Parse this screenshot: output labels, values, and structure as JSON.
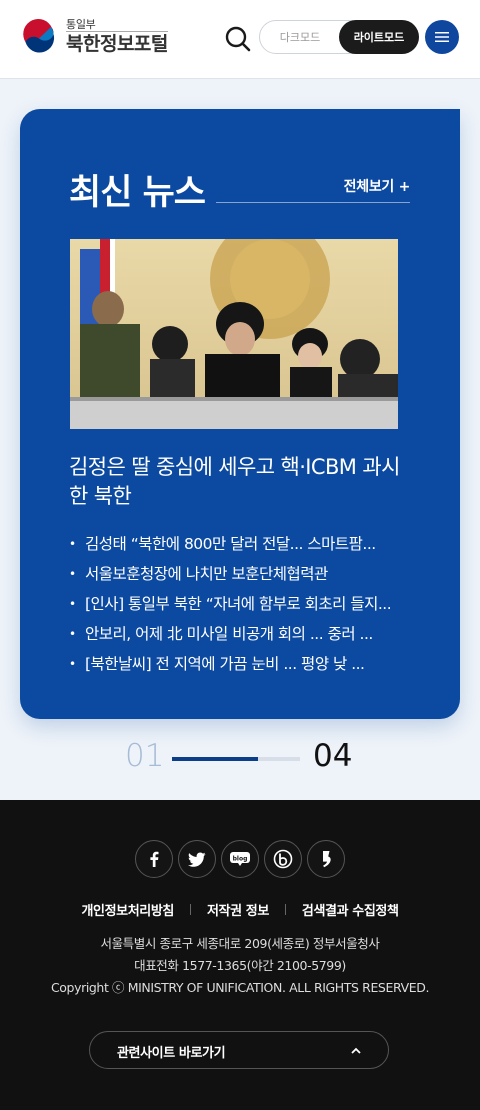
{
  "header": {
    "ministry": "통일부",
    "site_title": "북한정보포털",
    "dark_mode_label": "다크모드",
    "light_mode_label": "라이트모드",
    "active_mode": "light"
  },
  "news": {
    "heading": "최신 뉴스",
    "view_all": "전체보기 +",
    "photo_icon": "news-photo",
    "featured_title": "김정은 딸 중심에 세우고 핵·ICBM 과시한 북한",
    "items": [
      "김성태 “북한에 800만 달러 전달... 스마트팜...",
      "서울보훈청장에 나치만 보훈단체협력관",
      "[인사] 통일부 북한 “자녀에 함부로 회초리 들지...",
      "안보리, 어제 北 미사일 비공개 회의 ... 중러 ...",
      "[북한날씨] 전 지역에 가끔 눈비 ... 평양 낮 ..."
    ]
  },
  "pager": {
    "current": "01",
    "total": "04",
    "progress": 0.67
  },
  "footer": {
    "sns": [
      "facebook-icon",
      "twitter-icon",
      "blog-icon",
      "band-icon",
      "kakao-story-icon"
    ],
    "links": [
      "개인정보처리방침",
      "저작권 정보",
      "검색결과 수집정책"
    ],
    "address": "서울특별시 종로구 세종대로 209(세종로) 정부서울청사",
    "phone": "대표전화 1577-1365(야간 2100-5799)",
    "copyright": "Copyright ⓒ MINISTRY OF UNIFICATION. ALL RIGHTS RESERVED.",
    "related_sites": "관련사이트 바로가기"
  },
  "colors": {
    "primary": "#0b4aa0",
    "footer_bg": "#111111",
    "page_bg": "#eef3f9"
  }
}
